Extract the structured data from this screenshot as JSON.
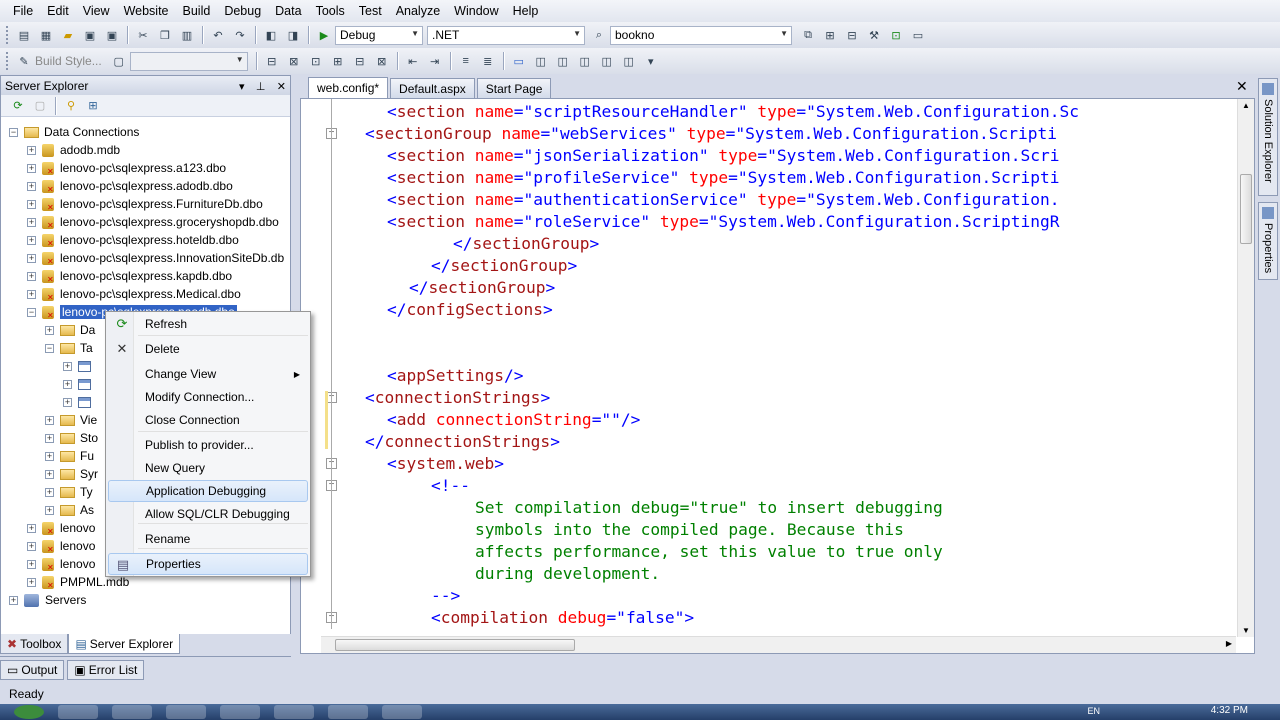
{
  "menubar": {
    "items": [
      "File",
      "Edit",
      "View",
      "Website",
      "Build",
      "Debug",
      "Data",
      "Tools",
      "Test",
      "Analyze",
      "Window",
      "Help"
    ]
  },
  "toolbar1": {
    "config_combo": "Debug",
    "platform_combo": ".NET",
    "find_combo": "bookno"
  },
  "toolbar2": {
    "build_style_label": "Build Style..."
  },
  "server_explorer": {
    "title": "Server Explorer",
    "root": "Data Connections",
    "items": [
      "adodb.mdb",
      "lenovo-pc\\sqlexpress.a123.dbo",
      "lenovo-pc\\sqlexpress.adodb.dbo",
      "lenovo-pc\\sqlexpress.FurnitureDb.dbo",
      "lenovo-pc\\sqlexpress.groceryshopdb.dbo",
      "lenovo-pc\\sqlexpress.hoteldb.dbo",
      "lenovo-pc\\sqlexpress.InnovationSiteDb.db",
      "lenovo-pc\\sqlexpress.kapdb.dbo",
      "lenovo-pc\\sqlexpress.Medical.dbo",
      "lenovo-pc\\sqlexpress.naodb.dbo"
    ],
    "children": [
      "Da",
      "Ta",
      "",
      "",
      "",
      "Vie",
      "Sto",
      "Fu",
      "Syr",
      "Ty",
      "As"
    ],
    "after_items": [
      "lenovo",
      "lenovo",
      "lenovo",
      "PMPML.mdb"
    ],
    "servers": "Servers"
  },
  "bottom_tabs": {
    "toolbox": "Toolbox",
    "server_explorer": "Server Explorer",
    "output": "Output",
    "error_list": "Error List"
  },
  "doc_tabs": [
    "web.config*",
    "Default.aspx",
    "Start Page"
  ],
  "side_tabs": [
    "Solution Explorer",
    "Properties"
  ],
  "context_menu": {
    "items": [
      "Refresh",
      "Delete",
      "Change View",
      "Modify Connection...",
      "Close Connection",
      "Publish to provider...",
      "New Query",
      "Application Debugging",
      "Allow SQL/CLR Debugging",
      "Rename",
      "Properties"
    ]
  },
  "code": {
    "lines": [
      {
        "indent": "    ",
        "parts": [
          [
            "b",
            "<"
          ],
          [
            "t",
            "section"
          ],
          [
            "k",
            " "
          ],
          [
            "a",
            "name"
          ],
          [
            "b",
            "=\""
          ],
          [
            "v",
            "scriptResourceHandler"
          ],
          [
            "b",
            "\""
          ],
          [
            "k",
            " "
          ],
          [
            "a",
            "type"
          ],
          [
            "b",
            "=\""
          ],
          [
            "v",
            "System.Web.Configuration.Sc"
          ]
        ]
      },
      {
        "indent": "    ",
        "parts": [
          [
            "b",
            "<"
          ],
          [
            "t",
            "sectionGroup"
          ],
          [
            "k",
            " "
          ],
          [
            "a",
            "name"
          ],
          [
            "b",
            "=\""
          ],
          [
            "v",
            "webServices"
          ],
          [
            "b",
            "\""
          ],
          [
            "k",
            " "
          ],
          [
            "a",
            "type"
          ],
          [
            "b",
            "=\""
          ],
          [
            "v",
            "System.Web.Configuration.Scripti"
          ]
        ]
      },
      {
        "indent": "      ",
        "parts": [
          [
            "b",
            "<"
          ],
          [
            "t",
            "section"
          ],
          [
            "k",
            " "
          ],
          [
            "a",
            "name"
          ],
          [
            "b",
            "=\""
          ],
          [
            "v",
            "jsonSerialization"
          ],
          [
            "b",
            "\""
          ],
          [
            "k",
            " "
          ],
          [
            "a",
            "type"
          ],
          [
            "b",
            "=\""
          ],
          [
            "v",
            "System.Web.Configuration.Scri"
          ]
        ]
      },
      {
        "indent": "      ",
        "parts": [
          [
            "b",
            "<"
          ],
          [
            "t",
            "section"
          ],
          [
            "k",
            " "
          ],
          [
            "a",
            "name"
          ],
          [
            "b",
            "=\""
          ],
          [
            "v",
            "profileService"
          ],
          [
            "b",
            "\""
          ],
          [
            "k",
            " "
          ],
          [
            "a",
            "type"
          ],
          [
            "b",
            "=\""
          ],
          [
            "v",
            "System.Web.Configuration.Scripti"
          ]
        ]
      },
      {
        "indent": "      ",
        "parts": [
          [
            "b",
            "<"
          ],
          [
            "t",
            "section"
          ],
          [
            "k",
            " "
          ],
          [
            "a",
            "name"
          ],
          [
            "b",
            "=\""
          ],
          [
            "v",
            "authenticationService"
          ],
          [
            "b",
            "\""
          ],
          [
            "k",
            " "
          ],
          [
            "a",
            "type"
          ],
          [
            "b",
            "=\""
          ],
          [
            "v",
            "System.Web.Configuration."
          ]
        ]
      },
      {
        "indent": "      ",
        "parts": [
          [
            "b",
            "<"
          ],
          [
            "t",
            "section"
          ],
          [
            "k",
            " "
          ],
          [
            "a",
            "name"
          ],
          [
            "b",
            "=\""
          ],
          [
            "v",
            "roleService"
          ],
          [
            "b",
            "\""
          ],
          [
            "k",
            " "
          ],
          [
            "a",
            "type"
          ],
          [
            "b",
            "=\""
          ],
          [
            "v",
            "System.Web.Configuration.ScriptingR"
          ]
        ]
      },
      {
        "indent": "    ",
        "parts": [
          [
            "b",
            "</"
          ],
          [
            "t",
            "sectionGroup"
          ],
          [
            "b",
            ">"
          ]
        ]
      },
      {
        "indent": "  ",
        "parts": [
          [
            "b",
            "</"
          ],
          [
            "t",
            "sectionGroup"
          ],
          [
            "b",
            ">"
          ]
        ]
      },
      {
        "indent": "",
        "parts": [
          [
            "b",
            "</"
          ],
          [
            "t",
            "sectionGroup"
          ],
          [
            "b",
            ">"
          ]
        ]
      },
      {
        "indent": "",
        "parts": [
          [
            "b",
            "</"
          ],
          [
            "t",
            "configSections"
          ],
          [
            "b",
            ">"
          ]
        ]
      },
      {
        "indent": "",
        "parts": []
      },
      {
        "indent": "",
        "parts": []
      },
      {
        "indent": "",
        "parts": [
          [
            "b",
            "<"
          ],
          [
            "t",
            "appSettings"
          ],
          [
            "b",
            "/>"
          ]
        ]
      },
      {
        "indent": "",
        "parts": [
          [
            "b",
            "<"
          ],
          [
            "t",
            "connectionStrings"
          ],
          [
            "b",
            ">"
          ]
        ]
      },
      {
        "indent": "",
        "parts": [
          [
            "b",
            "<"
          ],
          [
            "t",
            "add"
          ],
          [
            "k",
            " "
          ],
          [
            "a",
            "connectionString"
          ],
          [
            "b",
            "=\"\"/>"
          ]
        ]
      },
      {
        "indent": "",
        "parts": [
          [
            "b",
            "</"
          ],
          [
            "t",
            "connectionStrings"
          ],
          [
            "b",
            ">"
          ]
        ]
      },
      {
        "indent": "",
        "parts": [
          [
            "b",
            "<"
          ],
          [
            "t",
            "system.web"
          ],
          [
            "b",
            ">"
          ]
        ]
      },
      {
        "indent": "",
        "parts": [
          [
            "b",
            "<!--"
          ]
        ]
      },
      {
        "indent": "",
        "parts": [
          [
            "c",
            "Set compilation debug=\"true\" to insert debugging"
          ]
        ]
      },
      {
        "indent": "",
        "parts": [
          [
            "c",
            "symbols into the compiled page. Because this"
          ]
        ]
      },
      {
        "indent": "",
        "parts": [
          [
            "c",
            "affects performance, set this value to true only"
          ]
        ]
      },
      {
        "indent": "",
        "parts": [
          [
            "c",
            "during development."
          ]
        ]
      },
      {
        "indent": "",
        "parts": [
          [
            "b",
            "-->"
          ]
        ]
      },
      {
        "indent": "",
        "parts": [
          [
            "b",
            "<"
          ],
          [
            "t",
            "compilation"
          ],
          [
            "k",
            " "
          ],
          [
            "a",
            "debug"
          ],
          [
            "b",
            "=\""
          ],
          [
            "v",
            "false"
          ],
          [
            "b",
            "\">"
          ]
        ]
      }
    ]
  },
  "status": {
    "text": "Ready",
    "clock": "4:32 PM",
    "lang": "EN"
  }
}
